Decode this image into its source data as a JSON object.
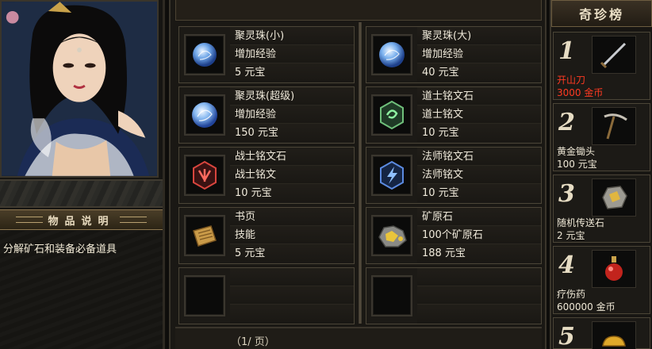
{
  "description_panel": {
    "title": "物品说明",
    "text": "分解矿石和装备必备道具"
  },
  "shop": {
    "items": [
      {
        "name": "聚灵珠(小)",
        "effect": "增加经验",
        "price": "5 元宝",
        "icon": "blue-orb-icon"
      },
      {
        "name": "聚灵珠(大)",
        "effect": "增加经验",
        "price": "40 元宝",
        "icon": "blue-orb-icon"
      },
      {
        "name": "聚灵珠(超级)",
        "effect": "增加经验",
        "price": "150 元宝",
        "icon": "blue-orb-icon"
      },
      {
        "name": "道士铭文石",
        "effect": "道士铭文",
        "price": "10 元宝",
        "icon": "taoist-rune-icon"
      },
      {
        "name": "战士铭文石",
        "effect": "战士铭文",
        "price": "10 元宝",
        "icon": "warrior-rune-icon"
      },
      {
        "name": "法师铭文石",
        "effect": "法师铭文",
        "price": "10 元宝",
        "icon": "mage-rune-icon"
      },
      {
        "name": "书页",
        "effect": "技能",
        "price": "5 元宝",
        "icon": "book-page-icon"
      },
      {
        "name": "矿原石",
        "effect": "100个矿原石",
        "price": "188 元宝",
        "icon": "ore-icon"
      }
    ],
    "pager_text": "（1/ 页）"
  },
  "ranking": {
    "title": "奇珍榜",
    "entries": [
      {
        "rank": "1",
        "name": "开山刀",
        "price": "3000 金币",
        "icon": "sword-icon",
        "highlight": true
      },
      {
        "rank": "2",
        "name": "黄金锄头",
        "price": "100 元宝",
        "icon": "pickaxe-icon",
        "highlight": false
      },
      {
        "rank": "3",
        "name": "随机传送石",
        "price": "2 元宝",
        "icon": "teleport-stone-icon",
        "highlight": false
      },
      {
        "rank": "4",
        "name": "疗伤药",
        "price": "600000 金币",
        "icon": "potion-icon",
        "highlight": false
      },
      {
        "rank": "5",
        "name": "",
        "price": "",
        "icon": "gold-ingot-icon",
        "highlight": false
      }
    ]
  },
  "colors": {
    "highlight_price": "#ff3a22",
    "panel_border": "#4b4537"
  }
}
